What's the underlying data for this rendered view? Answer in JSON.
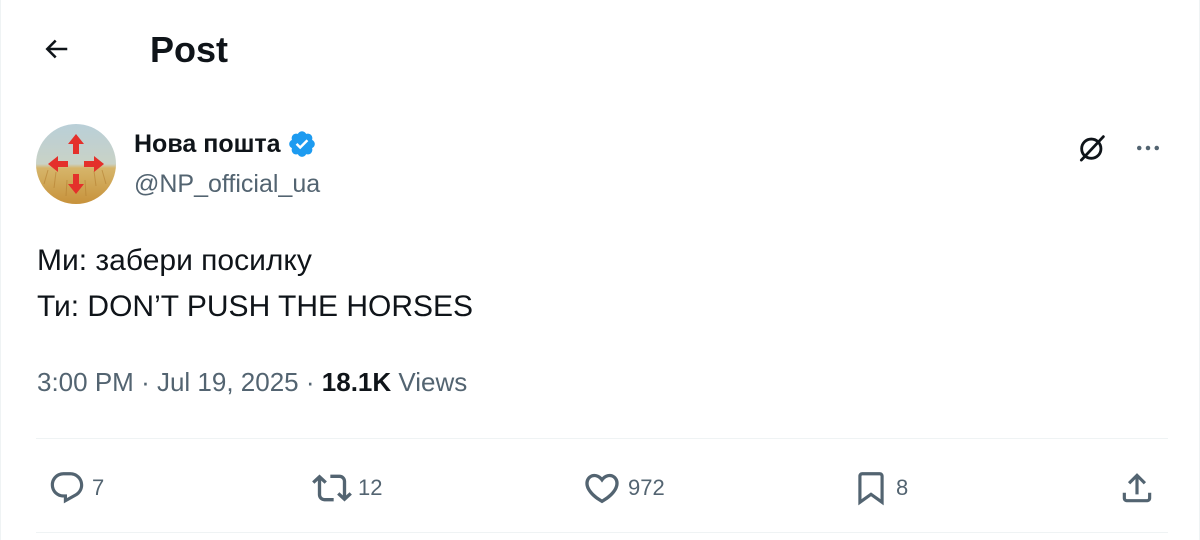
{
  "header": {
    "title": "Post",
    "back_icon": "arrow-left-icon"
  },
  "author": {
    "display_name": "Нова пошта",
    "handle": "@NP_official_ua",
    "verified": true,
    "verified_color": "#1d9bf0"
  },
  "tweet": {
    "lines": [
      "Ми: забери посилку",
      "Ти: DON’T PUSH THE HORSES"
    ]
  },
  "meta": {
    "time": "3:00 PM",
    "separator": "·",
    "date": "Jul 19, 2025",
    "views_count": "18.1K",
    "views_label": "Views"
  },
  "actions": {
    "reply_count": "7",
    "repost_count": "12",
    "like_count": "972",
    "bookmark_count": "8"
  },
  "colors": {
    "text_primary": "#0f1419",
    "text_secondary": "#536471",
    "divider": "#eff3f4",
    "brand_red": "#e4302b"
  }
}
